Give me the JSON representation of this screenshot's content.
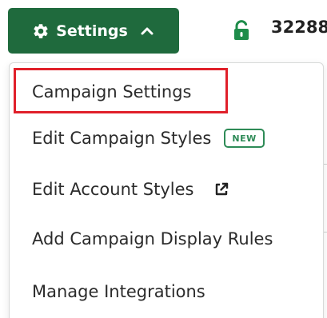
{
  "header": {
    "settings_label": "Settings",
    "campaign_id": "32288"
  },
  "menu": {
    "items": [
      {
        "label": "Campaign Settings"
      },
      {
        "label": "Edit Campaign Styles",
        "badge": "NEW"
      },
      {
        "label": "Edit Account Styles"
      },
      {
        "label": "Add Campaign Display Rules"
      },
      {
        "label": "Manage Integrations"
      }
    ]
  },
  "icons": {
    "settings": "gear-icon",
    "toggle": "chevron-up-icon",
    "lock": "unlocked-lock-icon",
    "external": "external-link-icon"
  },
  "colors": {
    "button_bg": "#1f6a3d",
    "lock": "#1e8c4a",
    "badge": "#2e8b57",
    "highlight": "#e0202a"
  }
}
